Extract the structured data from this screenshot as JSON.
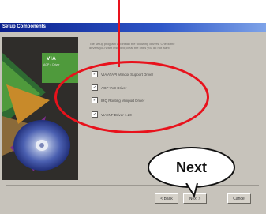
{
  "window": {
    "title": "Setup Components"
  },
  "panel": {
    "brand": "VIA",
    "subtitle": "AGP 4 Driver"
  },
  "description": "The setup program will install the following drivers. Check the drivers you want installed; clear the ones you do not want.",
  "components": [
    {
      "label": "VIA ATAPI Vendor Support Driver",
      "checked": true
    },
    {
      "label": "AGP VxD Driver",
      "checked": true
    },
    {
      "label": "IRQ Routing Miniport Driver",
      "checked": true
    },
    {
      "label": "VIA INF Driver 1.20",
      "checked": true
    }
  ],
  "buttons": {
    "back": "< Back",
    "next": "Next >",
    "cancel": "Cancel"
  },
  "annotation": {
    "callout_text": "Next"
  },
  "colors": {
    "accent": "#e8121c",
    "titlebar": "#0a1f8c",
    "dialog": "#c7c3bb"
  }
}
